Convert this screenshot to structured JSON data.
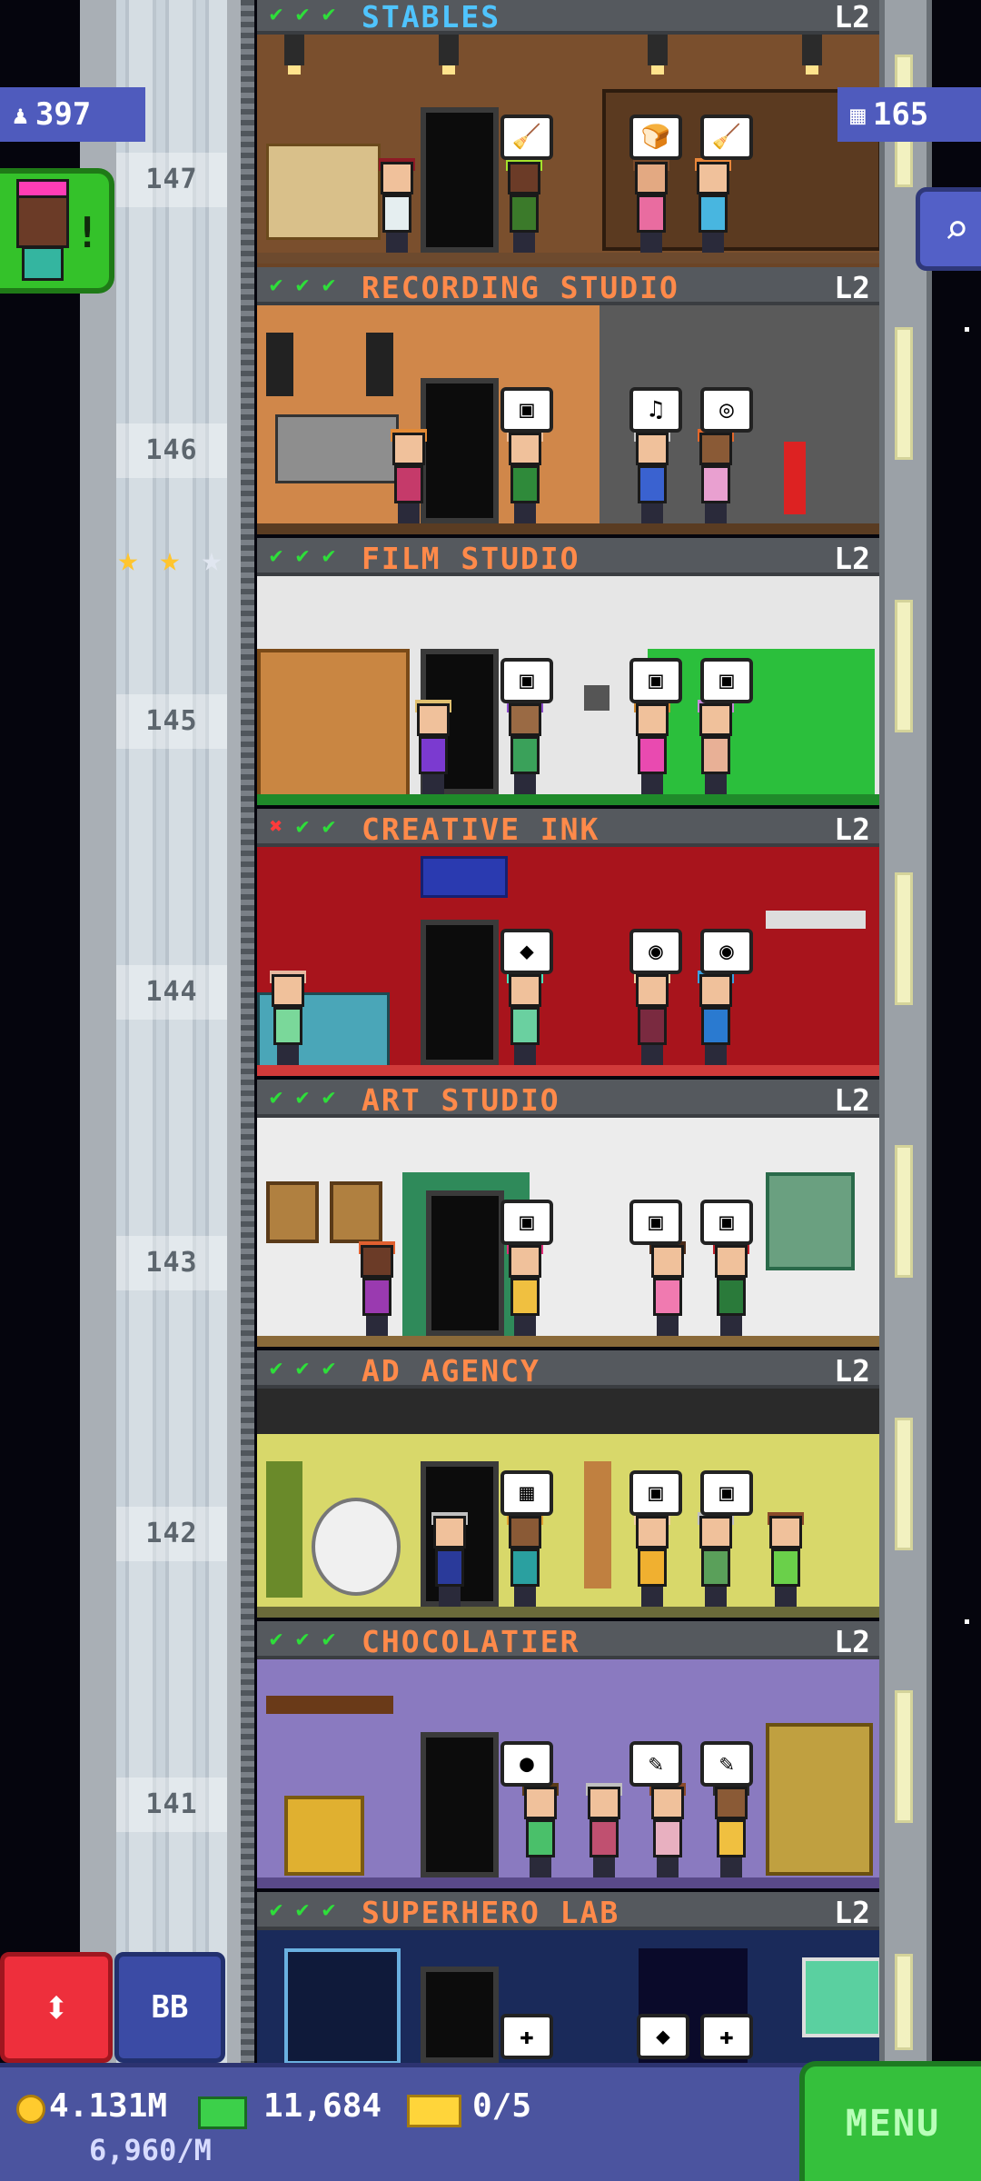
{
  "top_left_counter": {
    "icon": "population-icon",
    "value": "397"
  },
  "top_right_counter": {
    "icon": "floors-icon",
    "value": "165"
  },
  "elevator": {
    "floor_numbers": [
      "147",
      "146",
      "145",
      "144",
      "143",
      "142",
      "141"
    ]
  },
  "stars": [
    "★",
    "★",
    "★"
  ],
  "floors": [
    {
      "name": "STABLES",
      "level": "L2",
      "checks": [
        "✔",
        "✔",
        "✔"
      ],
      "name_color": "#4fc4ff",
      "bubbles": [
        "🧹",
        "🍞",
        "🧹"
      ]
    },
    {
      "name": "RECORDING STUDIO",
      "level": "L2",
      "checks": [
        "✔",
        "✔",
        "✔"
      ],
      "name_color": "#ff8a4a",
      "bubbles": [
        "▣",
        "♫",
        "◎"
      ]
    },
    {
      "name": "FILM STUDIO",
      "level": "L2",
      "checks": [
        "✔",
        "✔",
        "✔"
      ],
      "name_color": "#ff8a4a",
      "bubbles": [
        "▣",
        "▣",
        "▣"
      ]
    },
    {
      "name": "CREATIVE INK",
      "level": "L2",
      "checks": [
        "✖",
        "✔",
        "✔"
      ],
      "name_color": "#ff8a4a",
      "bubbles": [
        "◆",
        "◉",
        "◉"
      ]
    },
    {
      "name": "ART STUDIO",
      "level": "L2",
      "checks": [
        "✔",
        "✔",
        "✔"
      ],
      "name_color": "#ff8a4a",
      "bubbles": [
        "▣",
        "▣",
        "▣"
      ]
    },
    {
      "name": "AD AGENCY",
      "level": "L2",
      "checks": [
        "✔",
        "✔",
        "✔"
      ],
      "name_color": "#ff8a4a",
      "bubbles": [
        "▦",
        "▣",
        "▣"
      ]
    },
    {
      "name": "CHOCOLATIER",
      "level": "L2",
      "checks": [
        "✔",
        "✔",
        "✔"
      ],
      "name_color": "#ff8a4a",
      "bubbles": [
        "●",
        "✎",
        "✎"
      ]
    },
    {
      "name": "SUPERHERO LAB",
      "level": "L2",
      "checks": [
        "✔",
        "✔",
        "✔"
      ],
      "name_color": "#ff8a4a",
      "bubbles": [
        "✚",
        "◆",
        "✚"
      ]
    }
  ],
  "bottom_bar": {
    "coins": "4.131M",
    "coins_rate": "6,960/M",
    "bux": "11,684",
    "tickets": "0/5"
  },
  "buttons": {
    "elevator_label": "⬍",
    "bb_label": "BB",
    "menu_label": "MENU",
    "search_icon": "⌕",
    "alert_mark": "!"
  }
}
